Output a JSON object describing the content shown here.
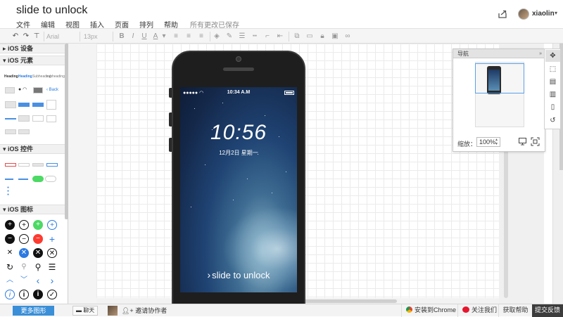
{
  "header": {
    "title": "slide to unlock",
    "menu": [
      "文件",
      "编辑",
      "视图",
      "插入",
      "页面",
      "排列",
      "帮助"
    ],
    "save_status": "所有更改已保存",
    "username": "xiaolin"
  },
  "toolbar": {
    "font": "Arial",
    "font_size": "13px",
    "bold": "B",
    "italic": "I",
    "underline": "U",
    "font_color": "A"
  },
  "left_panel": {
    "sections": [
      "iOS 设备",
      "iOS 元素",
      "iOS 控件",
      "iOS 图标"
    ],
    "more_shapes": "更多图形",
    "sample_labels": [
      "Heading",
      "Heading",
      "Subheading",
      "subheading",
      "Back"
    ]
  },
  "phone": {
    "status_time": "10:34 A.M",
    "lock_time": "10:56",
    "lock_date": "12月2日 星期一",
    "slide_text": "slide to unlock",
    "slide_chevron": "›"
  },
  "navigator": {
    "title": "导航",
    "zoom_label": "缩放：",
    "zoom_value": "100%"
  },
  "bottom": {
    "chat": "聊天",
    "invite": "邀请协作者",
    "install_chrome": "安装到Chrome",
    "follow": "关注我们",
    "help": "获取帮助",
    "feedback": "提交反馈"
  }
}
